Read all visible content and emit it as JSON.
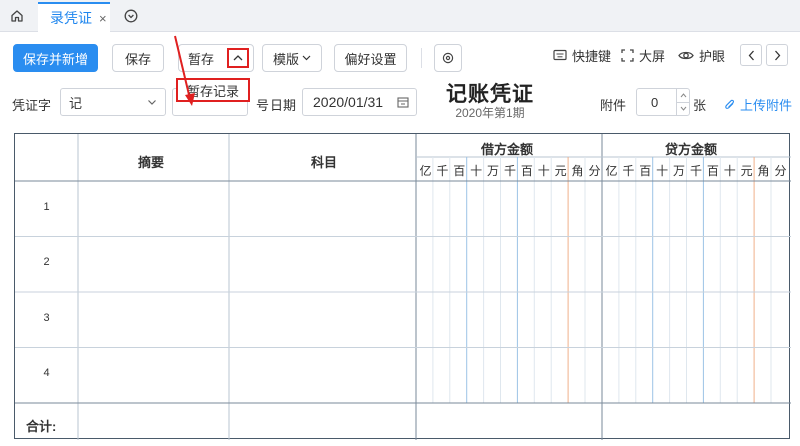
{
  "tabs": {
    "home_icon": "home-icon",
    "active_label": "录凭证",
    "close_glyph": "×",
    "more_icon": "chevron-circle-down-icon"
  },
  "toolbar": {
    "save_new": "保存并新增",
    "save": "保存",
    "temp_save": "暂存",
    "template": "模版",
    "preferences": "偏好设置",
    "shortcut": "快捷键",
    "fullscreen": "大屏",
    "eye_care": "护眼"
  },
  "dropdown": {
    "temp_record": "暂存记录"
  },
  "voucher": {
    "word_label": "凭证字",
    "word_value": "记",
    "number_suffix": "号",
    "date_label": "日期",
    "date_value": "2020/01/31",
    "title": "记账凭证",
    "period": "2020年第1期",
    "attach_label": "附件",
    "attach_count": "0",
    "attach_unit": "张",
    "upload": "上传附件"
  },
  "table": {
    "col_summary": "摘要",
    "col_subject": "科目",
    "col_debit": "借方金额",
    "col_credit": "贷方金额",
    "units": [
      "亿",
      "千",
      "百",
      "十",
      "万",
      "千",
      "百",
      "十",
      "元",
      "角",
      "分"
    ],
    "rows": [
      "1",
      "2",
      "3",
      "4"
    ],
    "total_label": "合计:"
  },
  "colors": {
    "accent": "#2a8df0",
    "highlight": "#e02020",
    "grid_border": "#4a5a6a"
  }
}
